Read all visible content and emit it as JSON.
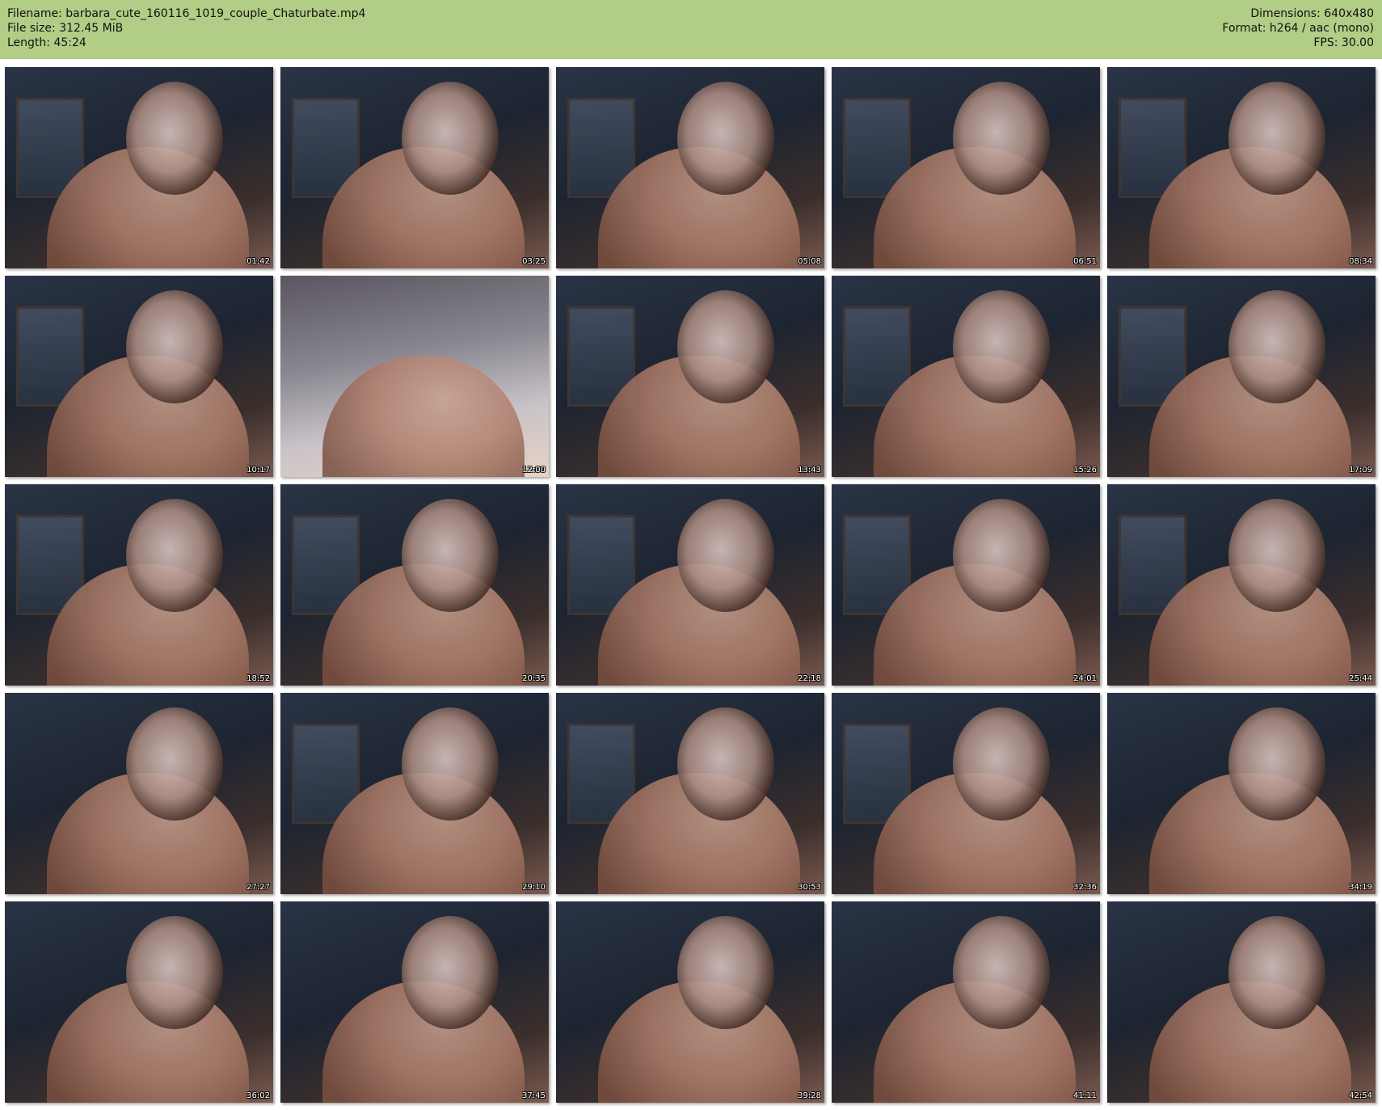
{
  "header": {
    "filename": "Filename: barbara_cute_160116_1019_couple_Chaturbate.mp4",
    "filesize": "File size: 312.45 MiB",
    "length": "Length: 45:24",
    "dimensions": "Dimensions: 640x480",
    "format": "Format: h264 / aac (mono)",
    "fps": "FPS: 30.00"
  },
  "colors": {
    "header_background": "#b2cd85",
    "page_background": "#ffffff"
  },
  "thumbnails": [
    {
      "time": "01:42"
    },
    {
      "time": "03:25"
    },
    {
      "time": "05:08"
    },
    {
      "time": "06:51"
    },
    {
      "time": "08:34"
    },
    {
      "time": "10:17"
    },
    {
      "time": "12:00"
    },
    {
      "time": "13:43"
    },
    {
      "time": "15:26"
    },
    {
      "time": "17:09"
    },
    {
      "time": "18:52"
    },
    {
      "time": "20:35"
    },
    {
      "time": "22:18"
    },
    {
      "time": "24:01"
    },
    {
      "time": "25:44"
    },
    {
      "time": "27:27"
    },
    {
      "time": "29:10"
    },
    {
      "time": "30:53"
    },
    {
      "time": "32:36"
    },
    {
      "time": "34:19"
    },
    {
      "time": "36:02"
    },
    {
      "time": "37:45"
    },
    {
      "time": "39:28"
    },
    {
      "time": "41:11"
    },
    {
      "time": "42:54"
    }
  ]
}
